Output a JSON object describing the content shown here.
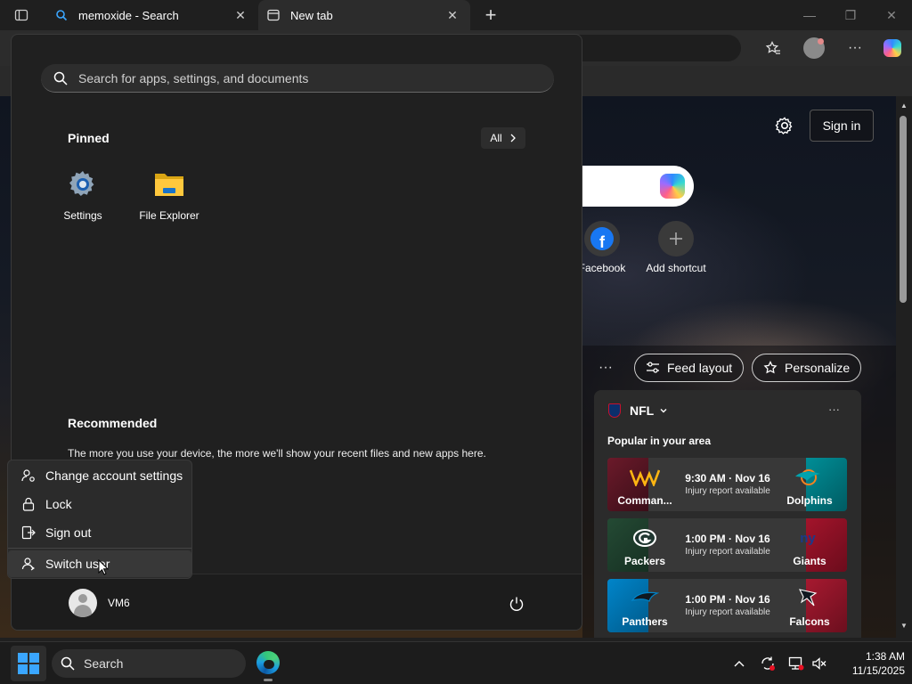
{
  "browser": {
    "tabs": [
      {
        "title": "memoxide - Search",
        "close": "✕"
      },
      {
        "title": "New tab",
        "close": "✕"
      }
    ],
    "new_tab": "+",
    "window_controls": {
      "minimize": "—",
      "restore": "❐",
      "close": "✕"
    },
    "toolbar_more": "···"
  },
  "new_tab_page": {
    "sign_in": "Sign in",
    "shortcuts": [
      {
        "label": "Facebook",
        "icon": "facebook-icon"
      },
      {
        "label": "Add shortcut",
        "icon": "plus-icon"
      }
    ],
    "more": "···",
    "feed_layout": "Feed layout",
    "personalize": "Personalize",
    "nfl": {
      "title": "NFL",
      "menu": "···",
      "subtitle": "Popular in your area",
      "games": [
        {
          "home": "Comman...",
          "away": "Dolphins",
          "time": "9:30 AM · Nov 16",
          "note": "Injury report available",
          "left_color": "#6b1a2a",
          "right_color": "#008e97"
        },
        {
          "home": "Packers",
          "away": "Giants",
          "time": "1:00 PM · Nov 16",
          "note": "Injury report available",
          "left_color": "#1e3a2a",
          "right_color": "#a3142b"
        },
        {
          "home": "Panthers",
          "away": "Falcons",
          "time": "1:00 PM · Nov 16",
          "note": "Injury report available",
          "left_color": "#0085ca",
          "right_color": "#a71930"
        }
      ]
    }
  },
  "start_menu": {
    "search_placeholder": "Search for apps, settings, and documents",
    "pinned_title": "Pinned",
    "all_button": "All",
    "pinned_apps": [
      {
        "label": "Settings",
        "icon": "settings-gear-icon"
      },
      {
        "label": "File Explorer",
        "icon": "folder-icon"
      }
    ],
    "recommended_title": "Recommended",
    "recommended_text": "The more you use your device, the more we'll show your recent files and new apps here.",
    "user_name": "VM6",
    "account_menu": [
      {
        "label": "Change account settings",
        "icon": "account-settings-icon"
      },
      {
        "label": "Lock",
        "icon": "lock-icon"
      },
      {
        "label": "Sign out",
        "icon": "sign-out-icon"
      },
      {
        "label": "Switch user",
        "icon": "switch-user-icon"
      }
    ]
  },
  "taskbar": {
    "search_placeholder": "Search",
    "time": "1:38 AM",
    "date": "11/15/2025"
  },
  "colors": {
    "accent": "#3aa6ff",
    "background": "#202020"
  }
}
